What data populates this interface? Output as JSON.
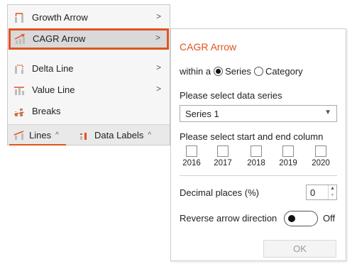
{
  "menu": {
    "items": [
      {
        "label": "Growth Arrow",
        "icon": "growth-arrow-icon",
        "has_submenu": true
      },
      {
        "label": "CAGR Arrow",
        "icon": "cagr-arrow-icon",
        "has_submenu": true,
        "selected": true
      },
      {
        "label": "Delta Line",
        "icon": "delta-line-icon",
        "has_submenu": true
      },
      {
        "label": "Value Line",
        "icon": "value-line-icon",
        "has_submenu": true
      },
      {
        "label": "Breaks",
        "icon": "breaks-icon",
        "has_submenu": false
      }
    ],
    "submenu_glyph": ">"
  },
  "toolbar": {
    "lines_label": "Lines",
    "data_labels_label": "Data Labels",
    "caret": "^"
  },
  "panel": {
    "title": "CAGR Arrow",
    "within_label": "within a",
    "option_series": "Series",
    "option_category": "Category",
    "selected_option": "Series",
    "series_prompt": "Please select data series",
    "series_value": "Series 1",
    "columns_prompt": "Please select start and end column",
    "years": [
      "2016",
      "2017",
      "2018",
      "2019",
      "2020"
    ],
    "decimal_label": "Decimal places (%)",
    "decimal_value": "0",
    "reverse_label": "Reverse arrow direction",
    "reverse_state": "Off",
    "ok_label": "OK"
  },
  "colors": {
    "accent": "#e0541f",
    "menu_bg": "#f6f6f6",
    "selected_bg": "#d9d9d9"
  }
}
